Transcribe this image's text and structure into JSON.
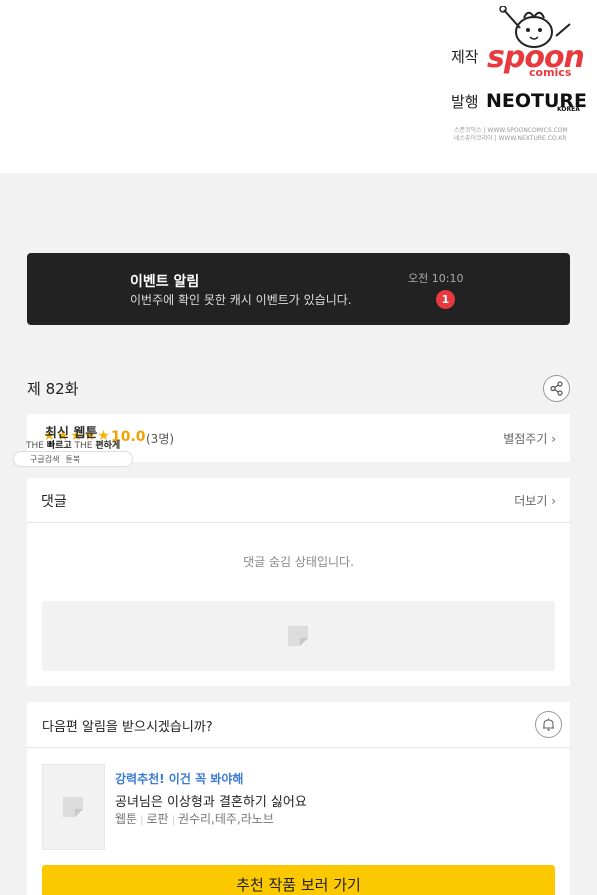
{
  "credits": {
    "producer_label": "제작",
    "producer_logo_text": "spoon",
    "producer_logo_sub": "comics",
    "publisher_label": "발행",
    "publisher_logo_text": "NEOTURE",
    "publisher_logo_sub": "KOREA",
    "address_line1": "스푼코믹스  |  WWW.SPOONCOMICS.COM",
    "address_line2": "네스츄어코리아  |  WWW.NEXTURE.CO.KR"
  },
  "event": {
    "title": "이벤트 알림",
    "description": "이번주에 확인 못한 캐시 이벤트가 있습니다.",
    "time": "오전 10:10",
    "badge_count": "1"
  },
  "episode": {
    "label": "제 82화"
  },
  "rating": {
    "stars": "★★★★★",
    "score": "10.0",
    "count": "(3명)",
    "rate_link": "별점주기 ›"
  },
  "overlay": {
    "title": "최신 웹툰",
    "slogan_pre": "THE ",
    "slogan_b1": "빠르고",
    "slogan_mid": " THE ",
    "slogan_b2": "편하게",
    "search_label": "구글검색",
    "app_label": "툰북"
  },
  "comments": {
    "title": "댓글",
    "more": "더보기 ›",
    "hidden_message": "댓글 숨김 상태입니다."
  },
  "next": {
    "question": "다음편 알림을 받으시겠습니까?",
    "rec_tag": "강력추천! 이건 꼭 봐야해",
    "rec_title": "공녀님은 이상형과 결혼하기 싫어요",
    "rec_genre1": "웹툰",
    "rec_genre2": "로판",
    "rec_authors": "권수리,테주,라노브",
    "button_label": "추천 작품 보러 가기"
  },
  "colors": {
    "accent_yellow": "#fcc800",
    "badge_red": "#e8393f",
    "link_blue": "#3a7bd5",
    "star_gold": "#f5b400"
  }
}
